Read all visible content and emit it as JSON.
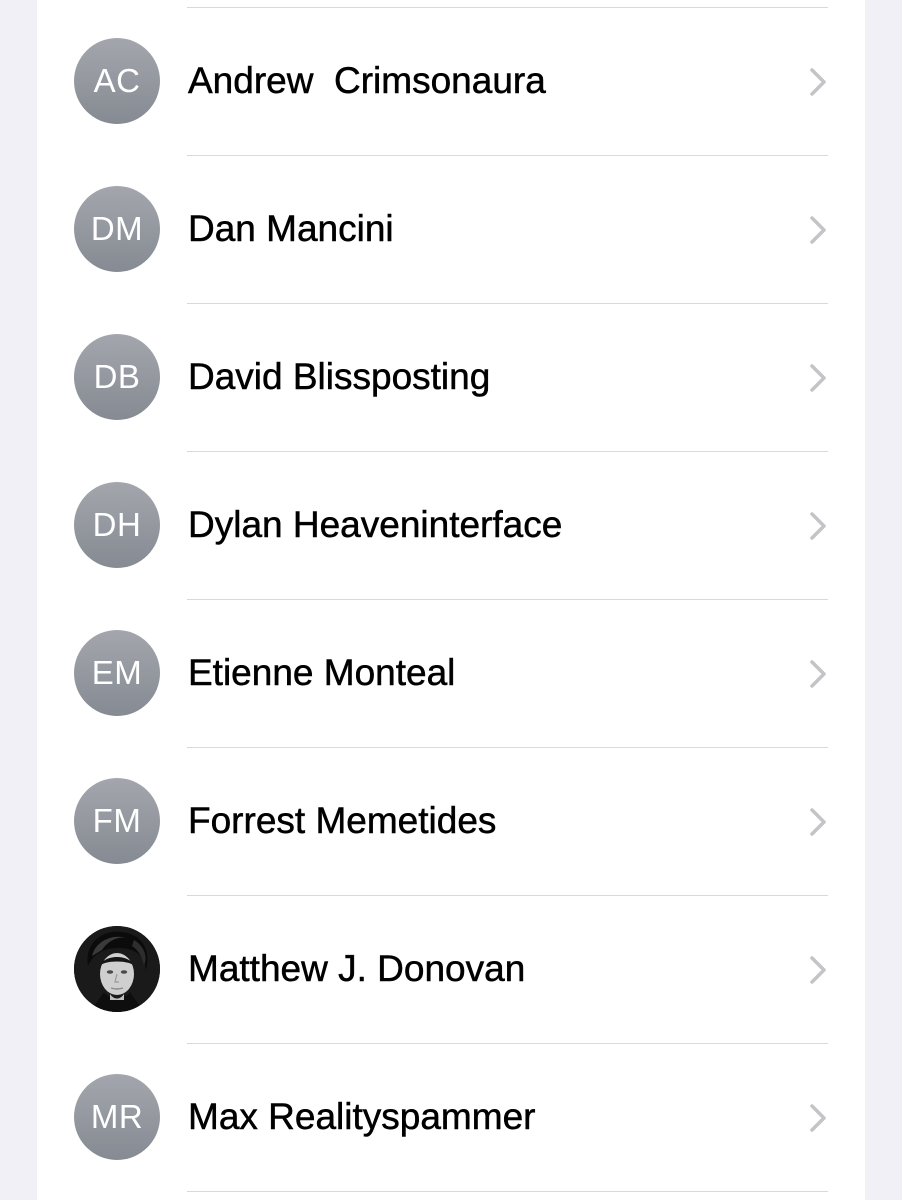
{
  "contacts": [
    {
      "initials": "AC",
      "name": "Andrew  Crimsonaura",
      "avatar": "initials"
    },
    {
      "initials": "DM",
      "name": "Dan Mancini",
      "avatar": "initials"
    },
    {
      "initials": "DB",
      "name": "David Blissposting",
      "avatar": "initials"
    },
    {
      "initials": "DH",
      "name": "Dylan Heaveninterface",
      "avatar": "initials"
    },
    {
      "initials": "EM",
      "name": "Etienne Monteal",
      "avatar": "initials"
    },
    {
      "initials": "FM",
      "name": "Forrest Memetides",
      "avatar": "initials"
    },
    {
      "initials": "",
      "name": "Matthew J. Donovan",
      "avatar": "photo"
    },
    {
      "initials": "MR",
      "name": "Max Realityspammer",
      "avatar": "initials"
    }
  ],
  "icons": {
    "disclosure": "chevron-right-icon"
  },
  "colors": {
    "background": "#f0f0f6",
    "card": "#ffffff",
    "avatar_gray": "#979aa1",
    "chevron": "#c4c4c8",
    "divider": "#d9d9dd"
  }
}
